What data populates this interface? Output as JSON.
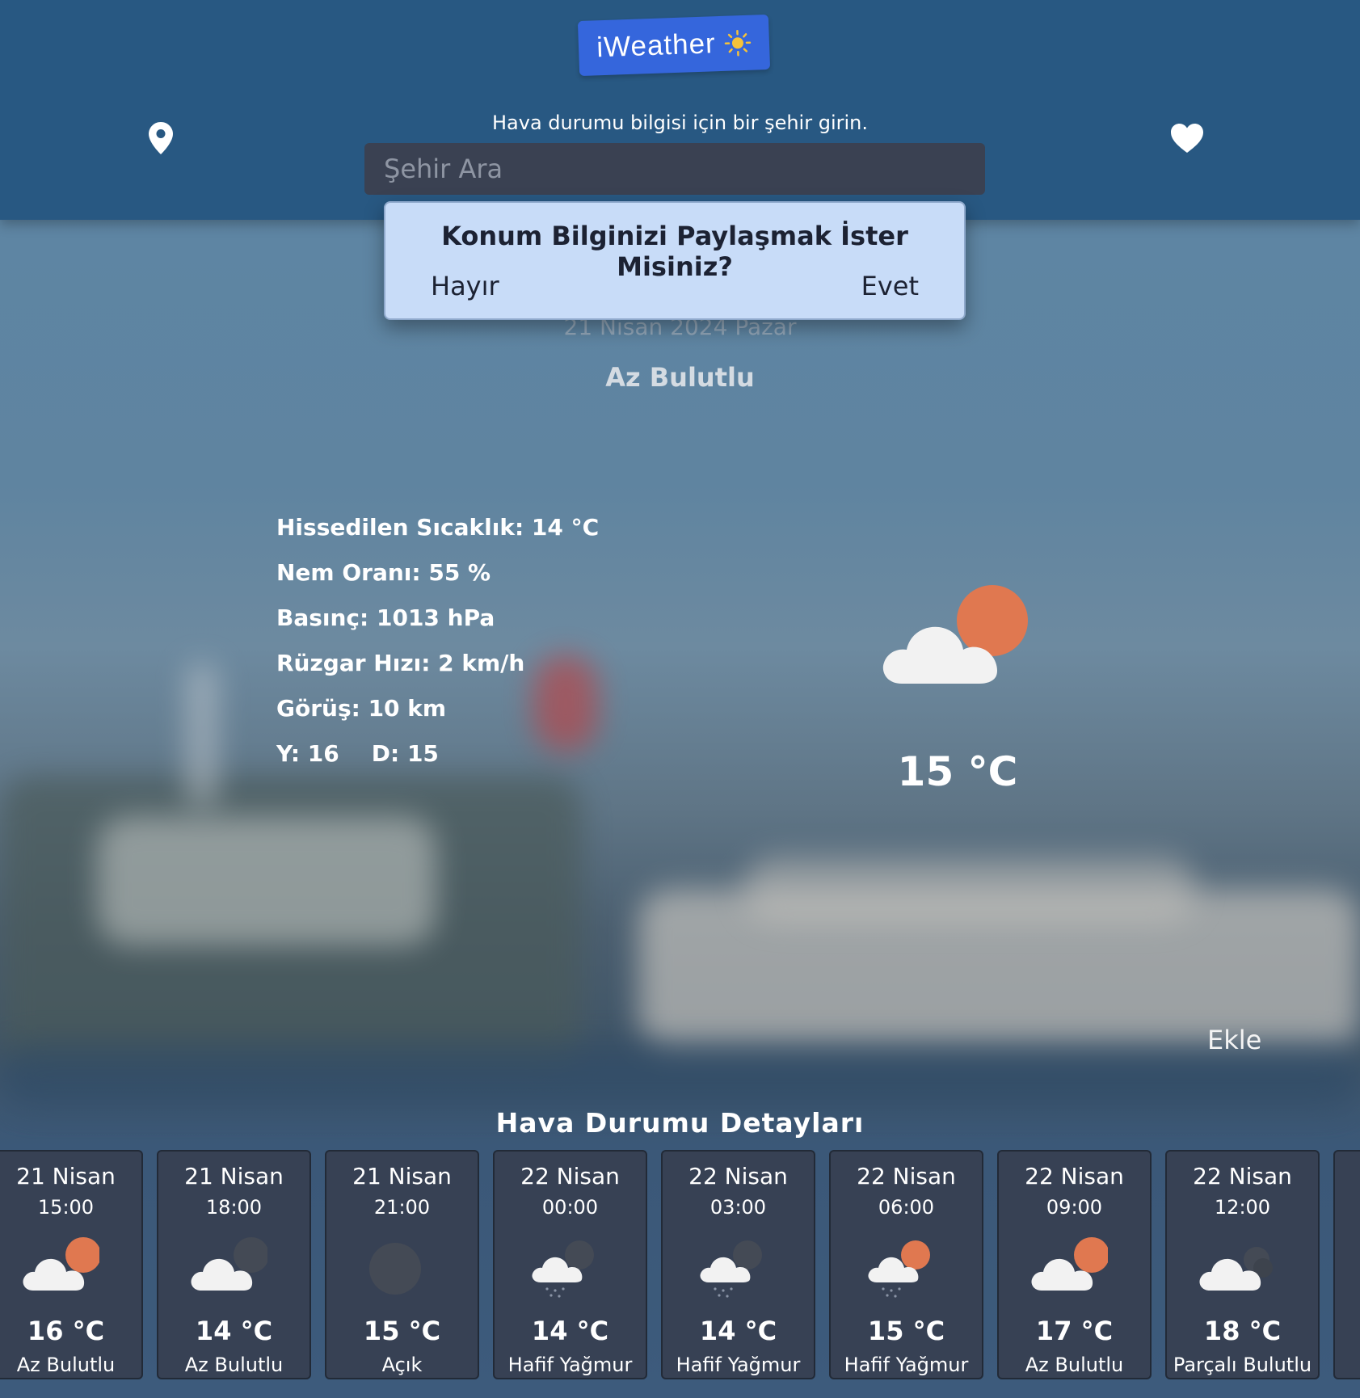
{
  "header": {
    "logo_text": "iWeather",
    "logo_icon": "sun-icon",
    "prompt": "Hava durumu bilgisi için bir şehir girin.",
    "search_placeholder": "Şehir Ara",
    "location_icon": "map-pin-icon",
    "favorite_icon": "heart-icon"
  },
  "dialog": {
    "question": "Konum Bilginizi Paylaşmak İster Misiniz?",
    "no_label": "Hayır",
    "yes_label": "Evet"
  },
  "current": {
    "date": "21 Nisan 2024 Pazar",
    "condition": "Az Bulutlu",
    "feels_like": "Hissedilen Sıcaklık: 14 °C",
    "humidity": "Nem Oranı: 55 %",
    "pressure": "Basınç: 1013 hPa",
    "wind": "Rüzgar Hızı: 2 km/h",
    "visibility": "Görüş: 10 km",
    "high": "Y: 16",
    "low": "D: 15",
    "temp": "15 °C",
    "icon": "partly-cloudy-day-icon"
  },
  "add_label": "Ekle",
  "forecast_title": "Hava Durumu Detayları",
  "forecast": [
    {
      "day": "21 Nisan",
      "time": "15:00",
      "temp": "16 °C",
      "cond": "Az Bulutlu",
      "icon": "partly-cloudy-day"
    },
    {
      "day": "21 Nisan",
      "time": "18:00",
      "temp": "14 °C",
      "cond": "Az Bulutlu",
      "icon": "partly-cloudy-night"
    },
    {
      "day": "21 Nisan",
      "time": "21:00",
      "temp": "15 °C",
      "cond": "Açık",
      "icon": "clear-night"
    },
    {
      "day": "22 Nisan",
      "time": "00:00",
      "temp": "14 °C",
      "cond": "Hafif Yağmur",
      "icon": "rain-night"
    },
    {
      "day": "22 Nisan",
      "time": "03:00",
      "temp": "14 °C",
      "cond": "Hafif Yağmur",
      "icon": "rain-night"
    },
    {
      "day": "22 Nisan",
      "time": "06:00",
      "temp": "15 °C",
      "cond": "Hafif Yağmur",
      "icon": "rain-day"
    },
    {
      "day": "22 Nisan",
      "time": "09:00",
      "temp": "17 °C",
      "cond": "Az Bulutlu",
      "icon": "partly-cloudy-day"
    },
    {
      "day": "22 Nisan",
      "time": "12:00",
      "temp": "18 °C",
      "cond": "Parçalı Bulutlu",
      "icon": "broken-clouds"
    }
  ],
  "colors": {
    "header_bg": "#285882",
    "logo_bg": "#3566dc",
    "dialog_bg": "#c8dcf8",
    "card_bg": "#374154",
    "sun": "#e07850"
  }
}
